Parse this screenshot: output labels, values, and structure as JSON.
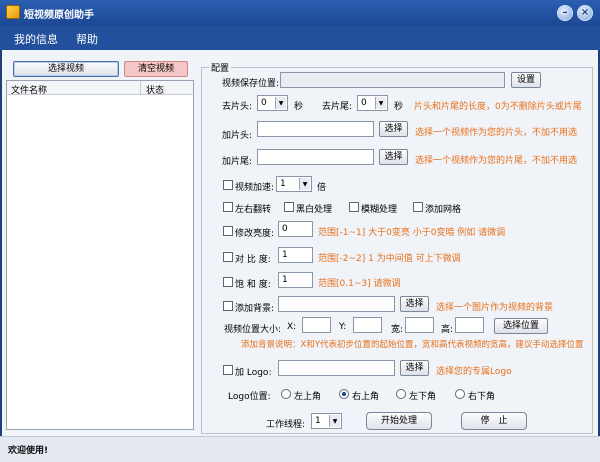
{
  "window": {
    "title": "短视频原创助手",
    "minimize_glyph": "–",
    "close_glyph": "×"
  },
  "menu": [
    "我的信息",
    "帮助"
  ],
  "left": {
    "select_video": "选择视频",
    "clear_video": "清空视频",
    "columns": [
      "文件名称",
      "状态"
    ]
  },
  "config": {
    "legend": "配置",
    "save_path": {
      "label": "视频保存位置:",
      "value": "",
      "button": "设置"
    },
    "trim": {
      "head_label": "去片头:",
      "head_value": "0",
      "tail_label": "去片尾:",
      "tail_value": "0",
      "unit": "秒",
      "hint": "片头和片尾的长度，0为不删除片头或片尾"
    },
    "add_head": {
      "label": "加片头:",
      "button": "选择",
      "hint": "选择一个视频作为您的片头，不加不用选"
    },
    "add_tail": {
      "label": "加片尾:",
      "button": "选择",
      "hint": "选择一个视频作为您的片尾，不加不用选"
    },
    "speed": {
      "label": "视频加速:",
      "value": "1",
      "unit": "倍",
      "checked": false
    },
    "effects": [
      {
        "label": "左右翻转",
        "checked": false
      },
      {
        "label": "黑白处理",
        "checked": false
      },
      {
        "label": "模糊处理",
        "checked": false
      },
      {
        "label": "添加网格",
        "checked": false
      }
    ],
    "brightness": {
      "label": "修改亮度:",
      "value": "0",
      "hint": "范围[-1~1]  大于0变亮 小于0变暗  例如 请微调",
      "checked": false
    },
    "contrast": {
      "label": "对 比 度:",
      "value": "1",
      "hint": "范围[-2~2]  1 为中间值  可上下微调",
      "checked": false
    },
    "saturation": {
      "label": "饱 和 度:",
      "value": "1",
      "hint": "范围[0.1~3]  请微调",
      "checked": false
    },
    "background": {
      "label": "添加背景:",
      "button": "选择",
      "hint": "选择一个图片作为视频的背景",
      "checked": false
    },
    "position": {
      "label": "视频位置大小:",
      "x": "X:",
      "y": "Y:",
      "w": "宽:",
      "h": "高:",
      "button": "选择位置",
      "x_value": "",
      "y_value": "",
      "w_value": "",
      "h_value": ""
    },
    "bg_note": "添加背景说明：X和Y代表初步位置的起始位置，宽和高代表视频的宽高，建议手动选择位置",
    "logo": {
      "label": "加 Logo:",
      "button": "选择",
      "hint": "选择您的专属Logo",
      "checked": false
    },
    "logo_position": {
      "label": "Logo位置:",
      "options": [
        "左上角",
        "右上角",
        "左下角",
        "右下角"
      ],
      "selected": 1
    },
    "threads": {
      "label": "工作线程:",
      "value": "1"
    },
    "start_button": "开始处理",
    "stop_button": "停　止"
  },
  "status": "欢迎使用!",
  "colors": {
    "title_bar": "#2458aa",
    "menu_bar": "#23509c",
    "clear_button": "#f6c6c6",
    "hint": "#e8701a"
  },
  "icons": [
    "app-icon",
    "minimize-icon",
    "close-icon"
  ]
}
